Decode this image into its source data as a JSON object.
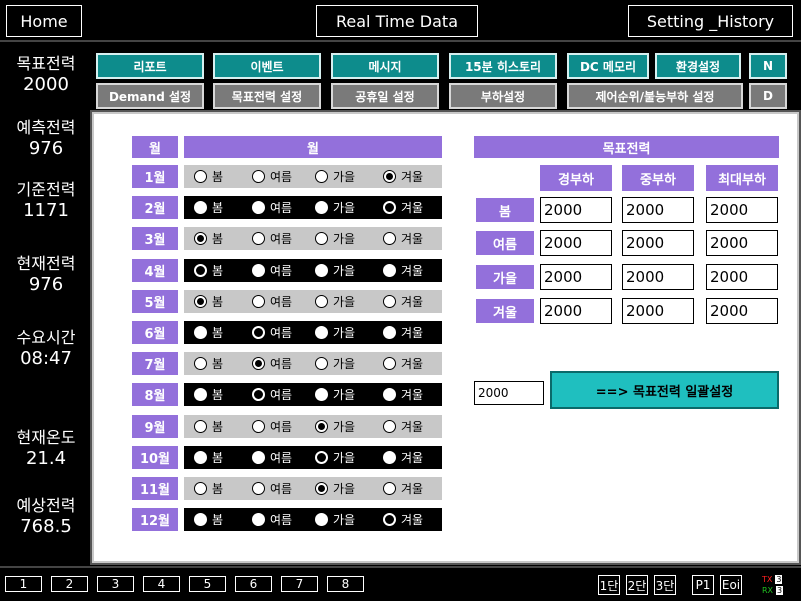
{
  "header": {
    "home_label": "Home",
    "title": "Real Time Data",
    "setting_label": "Setting _History"
  },
  "sidebar": {
    "metrics": [
      {
        "label": "목표전력",
        "value": "2000"
      },
      {
        "label": "예측전력",
        "value": "976"
      },
      {
        "label": "기준전력",
        "value": "1171"
      },
      {
        "label": "현재전력",
        "value": "976"
      },
      {
        "label": "수요시간",
        "value": "08:47"
      },
      {
        "label": "현재온도",
        "value": "21.4"
      },
      {
        "label": "예상전력",
        "value": "768.5"
      }
    ]
  },
  "nav": {
    "row1": [
      "리포트",
      "이벤트",
      "메시지",
      "15분 히스토리",
      "DC 메모리",
      "환경설정",
      "N"
    ],
    "row2": [
      "Demand 설정",
      "목표전력 설정",
      "공휴일 설정",
      "부하설정",
      "제어순위/불능부하 설정",
      "D"
    ]
  },
  "main": {
    "month_header": "월",
    "season_header": "월",
    "seasons": [
      "봄",
      "여름",
      "가을",
      "겨울"
    ],
    "months": [
      {
        "label": "1월",
        "selected": 3
      },
      {
        "label": "2월",
        "selected": 3
      },
      {
        "label": "3월",
        "selected": 0
      },
      {
        "label": "4월",
        "selected": 0
      },
      {
        "label": "5월",
        "selected": 0
      },
      {
        "label": "6월",
        "selected": 1
      },
      {
        "label": "7월",
        "selected": 1
      },
      {
        "label": "8월",
        "selected": 1
      },
      {
        "label": "9월",
        "selected": 2
      },
      {
        "label": "10월",
        "selected": 2
      },
      {
        "label": "11월",
        "selected": 2
      },
      {
        "label": "12월",
        "selected": 3
      }
    ],
    "target_header": "목표전력",
    "load_headers": [
      "경부하",
      "중부하",
      "최대부하"
    ],
    "target_rows": [
      {
        "season": "봄",
        "values": [
          "2000",
          "2000",
          "2000"
        ]
      },
      {
        "season": "여름",
        "values": [
          "2000",
          "2000",
          "2000"
        ]
      },
      {
        "season": "가을",
        "values": [
          "2000",
          "2000",
          "2000"
        ]
      },
      {
        "season": "겨울",
        "values": [
          "2000",
          "2000",
          "2000"
        ]
      }
    ],
    "bulk_value": "2000",
    "bulk_button": "==> 목표전력 일괄설정"
  },
  "footer": {
    "pages": [
      "1",
      "2",
      "3",
      "4",
      "5",
      "6",
      "7",
      "8"
    ],
    "right_buttons": [
      "1단",
      "2단",
      "3단",
      "P1",
      "Eoi"
    ],
    "tx_label": "TX",
    "rx_label": "RX",
    "tx_value": "3",
    "rx_value": "3",
    "tx_color": "#ff2020",
    "rx_color": "#20c020"
  }
}
